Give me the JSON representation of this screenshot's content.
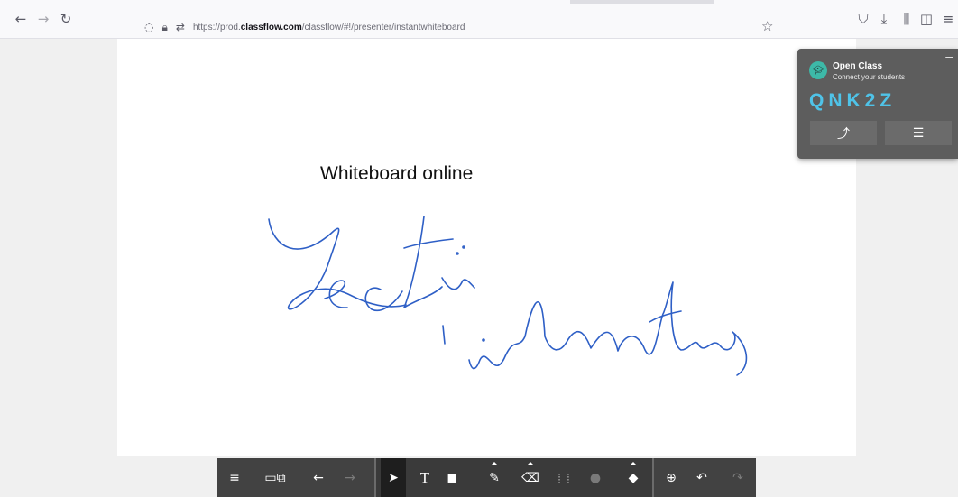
{
  "browser": {
    "back_icon": "arrow-left-icon",
    "forward_icon": "arrow-right-icon",
    "reload_icon": "reload-icon",
    "url_prefix": "https://prod.",
    "url_host": "classflow.com",
    "url_path": "/classflow/#!/presenter/instantwhiteboard"
  },
  "whiteboard": {
    "title": "Whiteboard online",
    "handwriting": [
      "Lectii",
      "interactive"
    ],
    "ink_color": "#2e5fc6"
  },
  "open_class": {
    "title": "Open Class",
    "subtitle": "Connect your students",
    "code": "QNK2Z",
    "minimize_label": "–",
    "accent": "#4fc3e8"
  },
  "toolbar": {
    "group1": [
      "menu-icon",
      "add-page-icon",
      "previous-page-icon",
      "next-page-icon"
    ],
    "group2": [
      "select-icon",
      "text-icon",
      "shapes-icon",
      "pen-icon",
      "highlighter-icon",
      "eraser-icon",
      "stamp-icon",
      "fill-icon"
    ],
    "group3": [
      "zoom-icon",
      "undo-icon",
      "redo-icon"
    ],
    "text_tool_label": "T"
  }
}
